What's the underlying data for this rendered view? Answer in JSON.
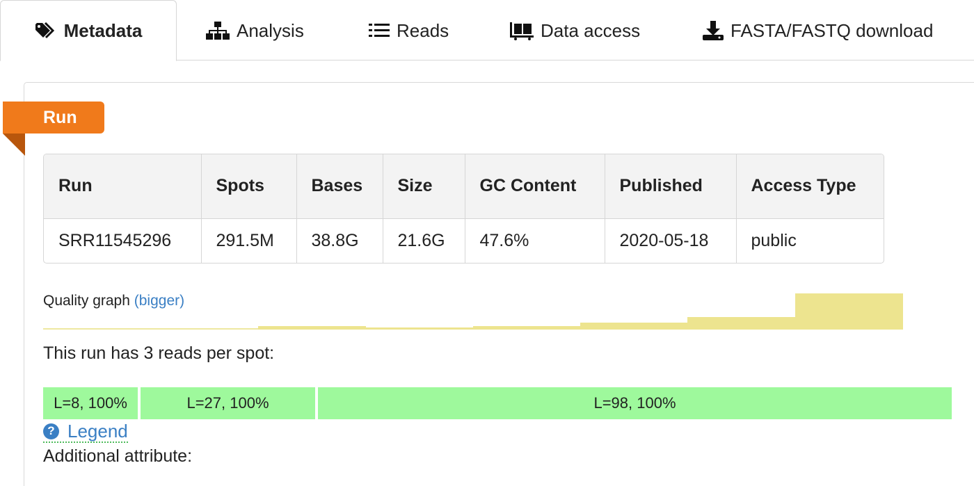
{
  "tabs": [
    {
      "label": "Metadata",
      "icon": "tags-icon"
    },
    {
      "label": "Analysis",
      "icon": "sitemap-icon"
    },
    {
      "label": "Reads",
      "icon": "list-icon"
    },
    {
      "label": "Data access",
      "icon": "dolly-icon"
    },
    {
      "label": "FASTA/FASTQ download",
      "icon": "download-icon"
    }
  ],
  "section": {
    "ribbon_label": "Run"
  },
  "run_table": {
    "headers": [
      "Run",
      "Spots",
      "Bases",
      "Size",
      "GC Content",
      "Published",
      "Access Type"
    ],
    "row": [
      "SRR11545296",
      "291.5M",
      "38.8G",
      "21.6G",
      "47.6%",
      "2020-05-18",
      "public"
    ]
  },
  "quality_graph": {
    "label": "Quality graph",
    "link": "(bigger)",
    "bar_color": "#ede48f",
    "levels": [
      0,
      0,
      0.1,
      0.05,
      0.1,
      0.2,
      0.35,
      1.0
    ]
  },
  "reads": {
    "summary": "This run has 3 reads per spot:",
    "segments": [
      "L=8, 100%",
      "L=27, 100%",
      "L=98, 100%"
    ],
    "segment_color": "#9ef99c"
  },
  "legend": {
    "label": "Legend",
    "icon": "question-circle-icon"
  },
  "additional_attribute": "Additional attribute:",
  "colors": {
    "accent": "#f07a1b",
    "link": "#3a7fc4"
  }
}
